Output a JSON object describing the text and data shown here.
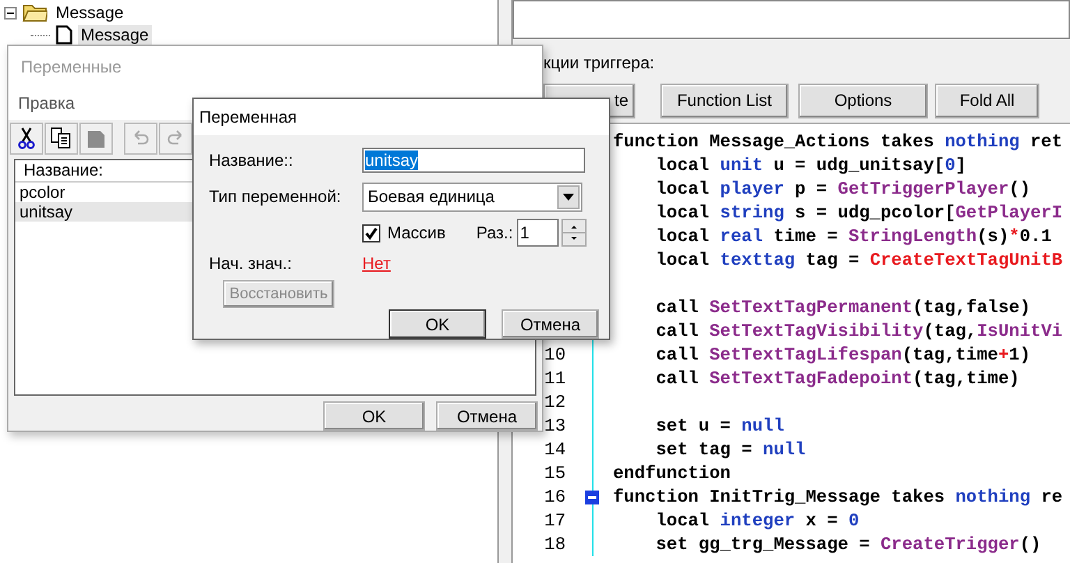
{
  "tree": {
    "items": [
      {
        "label": "Message",
        "kind": "folder",
        "expanded": true,
        "selected": false,
        "children": [
          {
            "label": "Message",
            "kind": "trigger",
            "selected": true
          }
        ]
      }
    ]
  },
  "trigger_panel": {
    "label": "кции триггера:",
    "buttons": [
      {
        "label": "te"
      },
      {
        "label": "Function List"
      },
      {
        "label": "Options"
      },
      {
        "label": "Fold All"
      }
    ]
  },
  "code_editor": {
    "lines": [
      {
        "tokens": [
          {
            "kind": "plain",
            "t": "function Message_Actions takes "
          },
          {
            "kind": "type",
            "t": "nothing"
          },
          {
            "kind": "plain",
            "t": " ret"
          }
        ]
      },
      {
        "tokens": [
          {
            "kind": "plain",
            "t": "    local "
          },
          {
            "kind": "type",
            "t": "unit"
          },
          {
            "kind": "plain",
            "t": " u = udg_unitsay["
          },
          {
            "kind": "number",
            "t": "0"
          },
          {
            "kind": "plain",
            "t": "]"
          }
        ]
      },
      {
        "tokens": [
          {
            "kind": "plain",
            "t": "    local "
          },
          {
            "kind": "type",
            "t": "player"
          },
          {
            "kind": "plain",
            "t": " p = "
          },
          {
            "kind": "native",
            "t": "GetTriggerPlayer"
          },
          {
            "kind": "plain",
            "t": "()"
          }
        ]
      },
      {
        "tokens": [
          {
            "kind": "plain",
            "t": "    local "
          },
          {
            "kind": "type",
            "t": "string"
          },
          {
            "kind": "plain",
            "t": " s = udg_pcolor["
          },
          {
            "kind": "native",
            "t": "GetPlayerI"
          }
        ]
      },
      {
        "tokens": [
          {
            "kind": "plain",
            "t": "    local "
          },
          {
            "kind": "type",
            "t": "real"
          },
          {
            "kind": "plain",
            "t": " time = "
          },
          {
            "kind": "native",
            "t": "StringLength"
          },
          {
            "kind": "plain",
            "t": "(s)"
          },
          {
            "kind": "operator",
            "t": "*"
          },
          {
            "kind": "plain",
            "t": "0.1"
          }
        ]
      },
      {
        "tokens": [
          {
            "kind": "plain",
            "t": "    local "
          },
          {
            "kind": "type",
            "t": "texttag"
          },
          {
            "kind": "plain",
            "t": " tag = "
          },
          {
            "kind": "bj",
            "t": "CreateTextTagUnitB"
          }
        ]
      },
      {
        "space_before": true,
        "tokens": [
          {
            "kind": "plain",
            "t": "    call "
          },
          {
            "kind": "native",
            "t": "SetTextTagPermanent"
          },
          {
            "kind": "plain",
            "t": "(tag,false)"
          }
        ]
      },
      {
        "tokens": [
          {
            "kind": "plain",
            "t": "    call "
          },
          {
            "kind": "native",
            "t": "SetTextTagVisibility"
          },
          {
            "kind": "plain",
            "t": "(tag,"
          },
          {
            "kind": "native",
            "t": "IsUnitVi"
          }
        ]
      },
      {
        "number": "10",
        "tokens": [
          {
            "kind": "plain",
            "t": "    call "
          },
          {
            "kind": "native",
            "t": "SetTextTagLifespan"
          },
          {
            "kind": "plain",
            "t": "(tag,time"
          },
          {
            "kind": "operator",
            "t": "+"
          },
          {
            "kind": "plain",
            "t": "1)"
          }
        ]
      },
      {
        "number": "11",
        "tokens": [
          {
            "kind": "plain",
            "t": "    call "
          },
          {
            "kind": "native",
            "t": "SetTextTagFadepoint"
          },
          {
            "kind": "plain",
            "t": "(tag,time)"
          }
        ]
      },
      {
        "number": "12"
      },
      {
        "number": "13",
        "tokens": [
          {
            "kind": "plain",
            "t": "    set u = "
          },
          {
            "kind": "type",
            "t": "null"
          }
        ]
      },
      {
        "number": "14",
        "tokens": [
          {
            "kind": "plain",
            "t": "    set tag = "
          },
          {
            "kind": "type",
            "t": "null"
          }
        ]
      },
      {
        "number": "15",
        "tokens": [
          {
            "kind": "plain",
            "t": "endfunction"
          }
        ]
      },
      {
        "number": "16",
        "fold": true,
        "tokens": [
          {
            "kind": "plain",
            "t": "function InitTrig_Message takes "
          },
          {
            "kind": "type",
            "t": "nothing"
          },
          {
            "kind": "plain",
            "t": " re"
          }
        ]
      },
      {
        "number": "17",
        "tokens": [
          {
            "kind": "plain",
            "t": "    local "
          },
          {
            "kind": "type",
            "t": "integer"
          },
          {
            "kind": "plain",
            "t": " x = "
          },
          {
            "kind": "number",
            "t": "0"
          }
        ]
      },
      {
        "number": "18",
        "tokens": [
          {
            "kind": "plain",
            "t": "    set gg_trg_Message = "
          },
          {
            "kind": "native",
            "t": "CreateTrigger"
          },
          {
            "kind": "plain",
            "t": "()"
          }
        ]
      }
    ]
  },
  "variables_dialog": {
    "title": "Переменные",
    "active": false,
    "menu": [
      "Правка"
    ],
    "toolbar": [
      {
        "kind": "cut",
        "disabled": false
      },
      {
        "kind": "copy",
        "disabled": false
      },
      {
        "kind": "paste",
        "disabled": true
      },
      {
        "kind": "undo",
        "disabled": true
      },
      {
        "kind": "redo",
        "disabled": true
      }
    ],
    "list": {
      "header": "Название:",
      "items": [
        {
          "label": "pcolor",
          "selected": false
        },
        {
          "label": "unitsay",
          "selected": true
        }
      ]
    },
    "buttons": [
      "OK",
      "Отмена"
    ]
  },
  "variable_dialog": {
    "title": "Переменная",
    "name_label": "Название::",
    "name_value": "unitsay",
    "name_selected": true,
    "type_label": "Тип переменной:",
    "type_value": "Боевая единица",
    "array": {
      "label": "Массив",
      "checked": true
    },
    "size_label": "Раз.:",
    "size_value": "1",
    "initial_label": "Нач. знач.:",
    "initial_value": "Нет",
    "reset_button": {
      "label": "Восстановить",
      "disabled": true
    },
    "buttons": [
      "OK",
      "Отмена"
    ]
  }
}
